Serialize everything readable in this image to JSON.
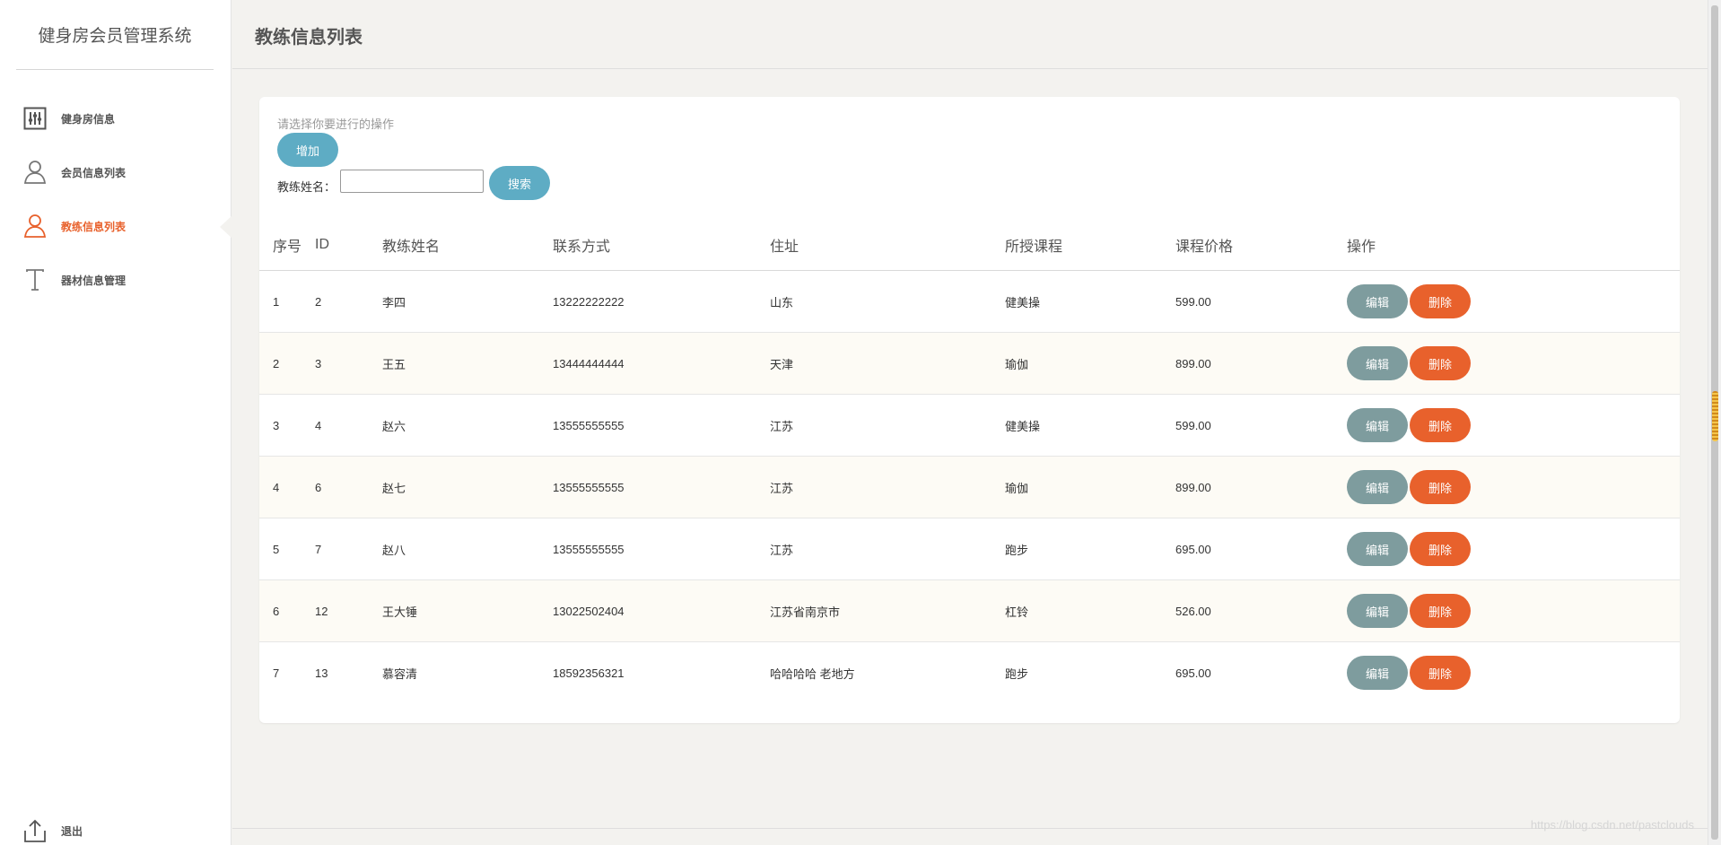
{
  "brand": "健身房会员管理系统",
  "sidebar": {
    "items": [
      {
        "label": "健身房信息",
        "icon": "sliders-icon",
        "active": false
      },
      {
        "label": "会员信息列表",
        "icon": "user-icon",
        "active": false
      },
      {
        "label": "教练信息列表",
        "icon": "user-icon",
        "active": true
      },
      {
        "label": "器材信息管理",
        "icon": "text-t-icon",
        "active": false
      }
    ],
    "logout": "退出"
  },
  "header": {
    "title": "教练信息列表"
  },
  "toolbar": {
    "hint": "请选择你要进行的操作",
    "add_label": "增加",
    "search_label": "教练姓名：",
    "search_value": "",
    "search_button": "搜索"
  },
  "table": {
    "columns": [
      "序号",
      "ID",
      "教练姓名",
      "联系方式",
      "住址",
      "所授课程",
      "课程价格",
      "操作"
    ],
    "rows": [
      [
        "1",
        "2",
        "李四",
        "13222222222",
        "山东",
        "健美操",
        "599.00"
      ],
      [
        "2",
        "3",
        "王五",
        "13444444444",
        "天津",
        "瑜伽",
        "899.00"
      ],
      [
        "3",
        "4",
        "赵六",
        "13555555555",
        "江苏",
        "健美操",
        "599.00"
      ],
      [
        "4",
        "6",
        "赵七",
        "13555555555",
        "江苏",
        "瑜伽",
        "899.00"
      ],
      [
        "5",
        "7",
        "赵八",
        "13555555555",
        "江苏",
        "跑步",
        "695.00"
      ],
      [
        "6",
        "12",
        "王大锤",
        "13022502404",
        "江苏省南京市",
        "杠铃",
        "526.00"
      ],
      [
        "7",
        "13",
        "慕容清",
        "18592356321",
        "哈哈哈哈 老地方",
        "跑步",
        "695.00"
      ]
    ],
    "edit_label": "编辑",
    "delete_label": "删除"
  },
  "watermark": "https://blog.csdn.net/pastclouds",
  "colors": {
    "accent": "#e8612c",
    "primary_button": "#5eacc4",
    "edit_button": "#7e9c9e",
    "active_nav": "#e8612c"
  }
}
